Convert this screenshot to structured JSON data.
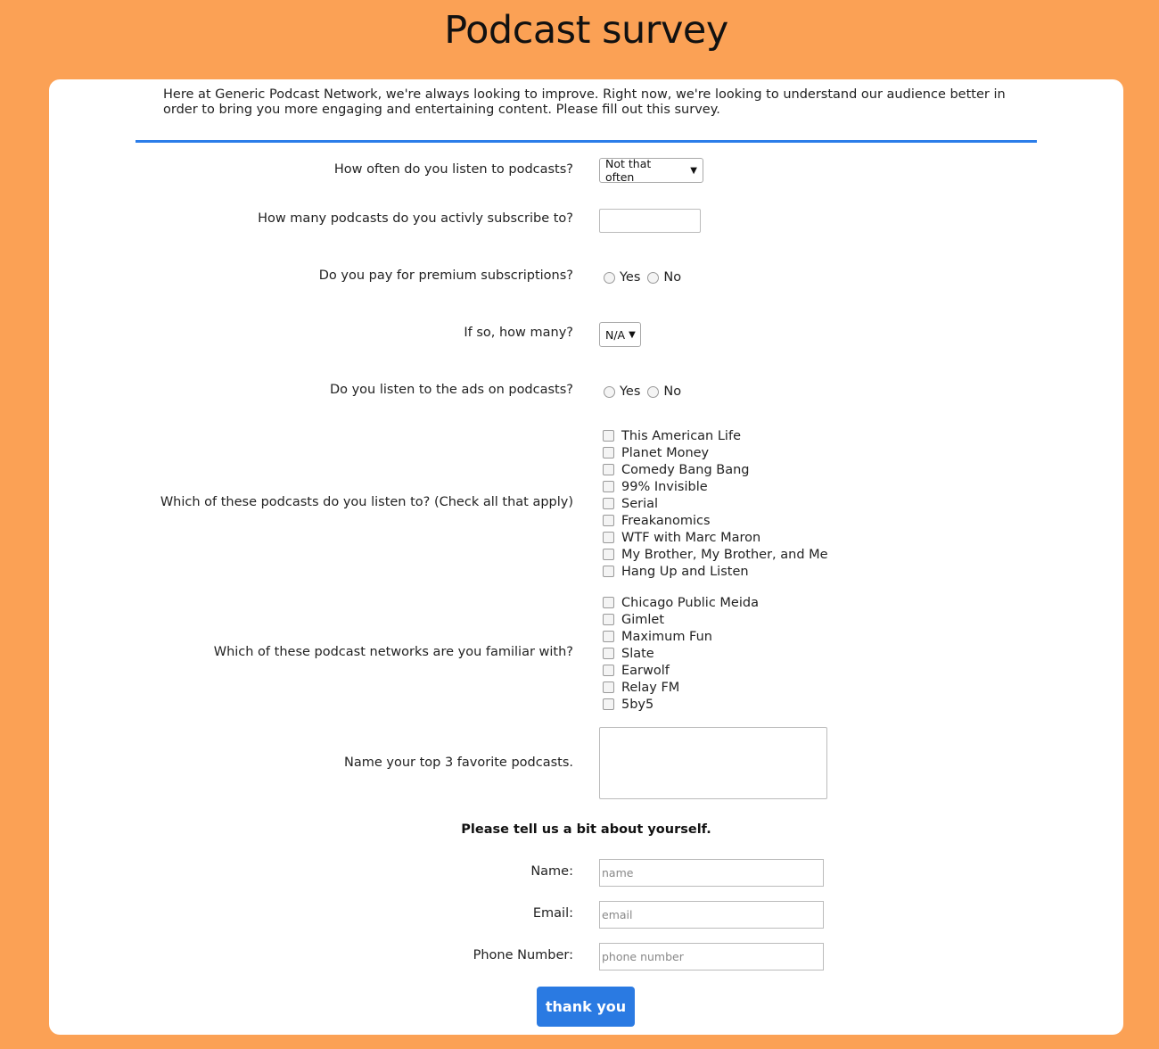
{
  "page": {
    "title": "Podcast survey"
  },
  "intro": "Here at Generic Podcast Network, we're always looking to improve. Right now, we're looking to understand our audience better in order to bring you more engaging and entertaining content. Please fill out this survey.",
  "questions": {
    "frequency": {
      "label": "How often do you listen to podcasts?",
      "selected": "Not that often"
    },
    "subscriptions": {
      "label": "How many podcasts do you activly subscribe to?",
      "value": ""
    },
    "premium": {
      "label": "Do you pay for premium subscriptions?",
      "yes": "Yes",
      "no": "No"
    },
    "premium_count": {
      "label": "If so, how many?",
      "selected": "N/A"
    },
    "ads": {
      "label": "Do you listen to the ads on podcasts?",
      "yes": "Yes",
      "no": "No"
    },
    "podcasts": {
      "label": "Which of these podcasts do you listen to? (Check all that apply)",
      "options": [
        "This American Life",
        "Planet Money",
        "Comedy Bang Bang",
        "99% Invisible",
        "Serial",
        "Freakanomics",
        "WTF with Marc Maron",
        "My Brother, My Brother, and Me",
        "Hang Up and Listen"
      ]
    },
    "networks": {
      "label": "Which of these podcast networks are you familiar with?",
      "options": [
        "Chicago Public Meida",
        "Gimlet",
        "Maximum Fun",
        "Slate",
        "Earwolf",
        "Relay FM",
        "5by5"
      ]
    },
    "favorites": {
      "label": "Name your top 3 favorite podcasts.",
      "value": ""
    }
  },
  "about": {
    "heading": "Please tell us a bit about yourself.",
    "name": {
      "label": "Name:",
      "placeholder": "name"
    },
    "email": {
      "label": "Email:",
      "placeholder": "email"
    },
    "phone": {
      "label": "Phone Number:",
      "placeholder": "phone number"
    }
  },
  "submit": {
    "label": "thank you"
  },
  "colors": {
    "background": "#fba155",
    "accent": "#2b7de9",
    "button": "#2a7ae2"
  }
}
